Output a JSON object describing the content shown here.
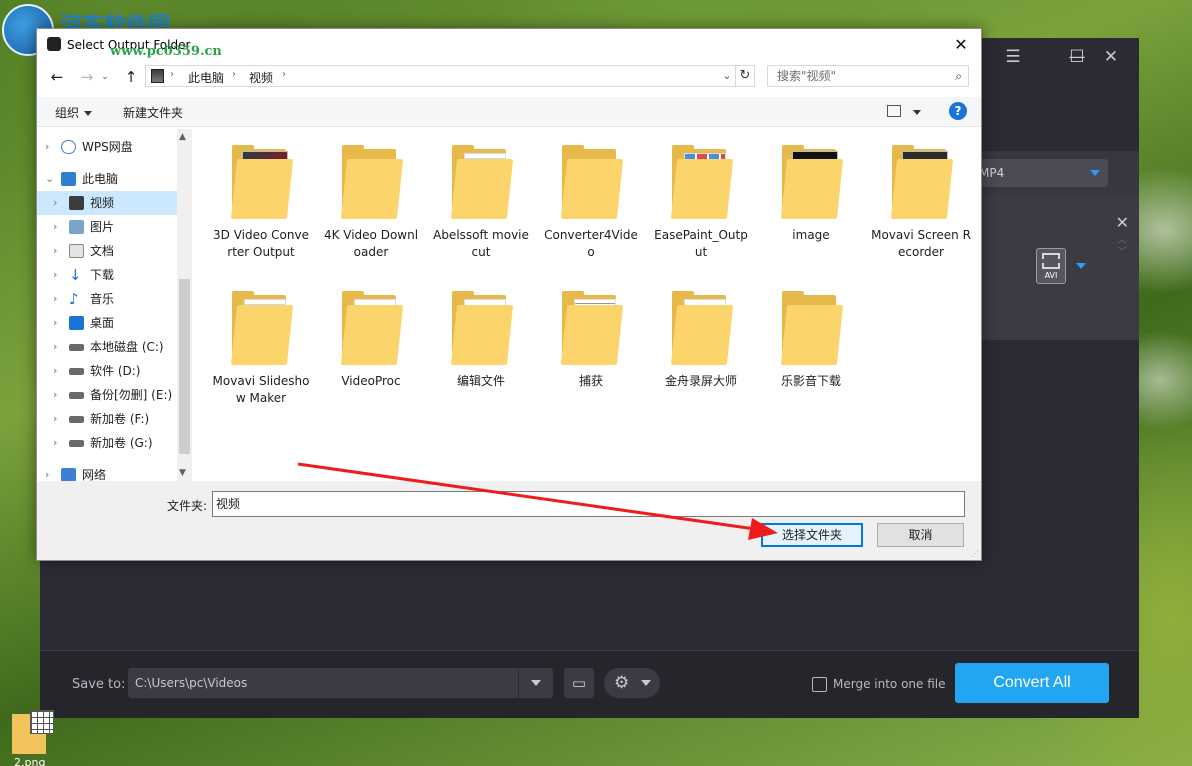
{
  "watermark": {
    "title": "河东软件园",
    "url": "www.pc0359.cn"
  },
  "app": {
    "output_format": "MP4",
    "row_format_badge": "AVI",
    "save_to_label": "Save to:",
    "save_path": "C:\\Users\\pc\\Videos",
    "merge_label": "Merge into one file",
    "merge_checked": false,
    "convert_all_label": "Convert All",
    "accent_color": "#22a6f2"
  },
  "dialog": {
    "title": "Select Output Folder",
    "breadcrumb": [
      "此电脑",
      "视频"
    ],
    "search_placeholder": "搜索\"视频\"",
    "toolbar": {
      "organize": "组织",
      "new_folder": "新建文件夹"
    },
    "nav": [
      {
        "label": "WPS网盘",
        "icon": "cloud-icon"
      },
      {
        "label": "此电脑",
        "icon": "computer-icon"
      },
      {
        "label": "视频",
        "icon": "video-folder-icon",
        "selected": true
      },
      {
        "label": "图片",
        "icon": "pictures-icon"
      },
      {
        "label": "文档",
        "icon": "documents-icon"
      },
      {
        "label": "下载",
        "icon": "download-icon"
      },
      {
        "label": "音乐",
        "icon": "music-icon"
      },
      {
        "label": "桌面",
        "icon": "desktop-icon"
      },
      {
        "label": "本地磁盘 (C:)",
        "icon": "drive-icon"
      },
      {
        "label": "软件 (D:)",
        "icon": "drive-icon"
      },
      {
        "label": "备份[勿删] (E:)",
        "icon": "drive-icon"
      },
      {
        "label": "新加卷 (F:)",
        "icon": "drive-icon"
      },
      {
        "label": "新加卷 (G:)",
        "icon": "drive-icon"
      },
      {
        "label": "网络",
        "icon": "network-icon"
      }
    ],
    "files": [
      {
        "name": "3D Video Converter Output",
        "kind": "video"
      },
      {
        "name": "4K Video Downloader",
        "kind": "plain"
      },
      {
        "name": "Abelssoft moviecut",
        "kind": "doc"
      },
      {
        "name": "Converter4Video",
        "kind": "plain"
      },
      {
        "name": "EasePaint_Output",
        "kind": "images"
      },
      {
        "name": "image",
        "kind": "red"
      },
      {
        "name": "Movavi Screen Recorder",
        "kind": "person"
      },
      {
        "name": "Movavi Slideshow Maker",
        "kind": "doc"
      },
      {
        "name": "VideoProc",
        "kind": "paper"
      },
      {
        "name": "编辑文件",
        "kind": "paper"
      },
      {
        "name": "捕获",
        "kind": "list"
      },
      {
        "name": "金舟录屏大师",
        "kind": "paper"
      },
      {
        "name": "乐影音下载",
        "kind": "plain"
      }
    ],
    "folder_label": "文件夹:",
    "folder_value": "视频",
    "select_button": "选择文件夹",
    "cancel_button": "取消"
  },
  "desktop_icon_label": "2.png"
}
